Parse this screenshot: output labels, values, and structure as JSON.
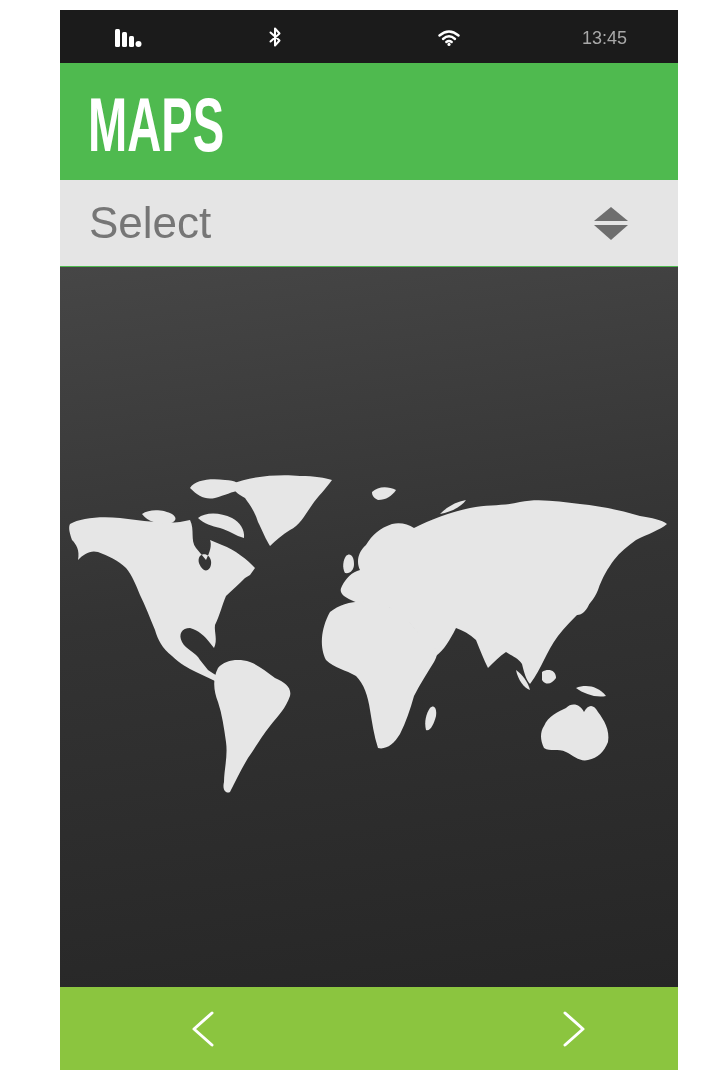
{
  "status_bar": {
    "time": "13:45"
  },
  "header": {
    "title": "MAPS"
  },
  "select": {
    "placeholder": "Select"
  }
}
